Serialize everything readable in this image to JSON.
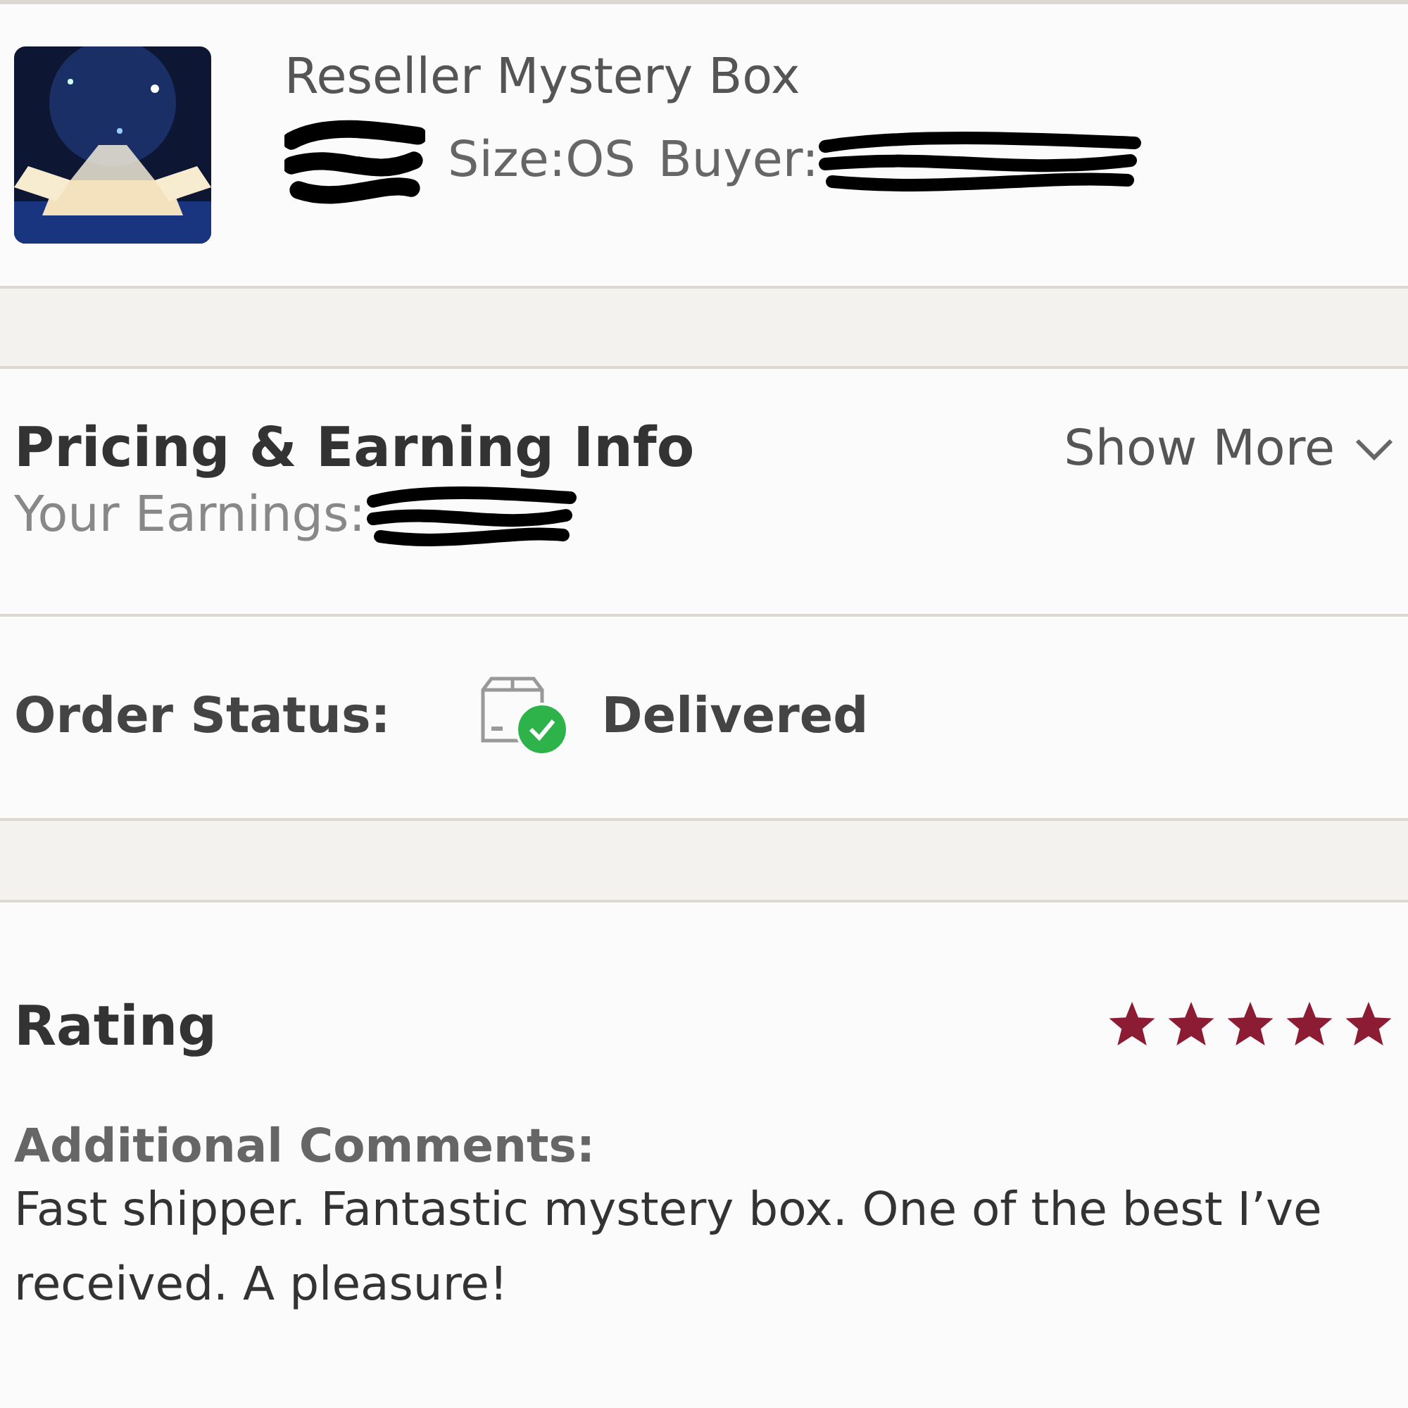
{
  "listing": {
    "title": "Reseller Mystery Box",
    "size": "Size:OS",
    "buyer_label": "Buyer:"
  },
  "pricing": {
    "title": "Pricing & Earning Info",
    "earnings_label": "Your Earnings:",
    "toggle": "Show More"
  },
  "order_status": {
    "label": "Order Status:",
    "status": "Delivered",
    "delivered": true
  },
  "rating": {
    "title": "Rating",
    "stars": 5,
    "comments_label": "Additional Comments:",
    "comment": "Fast shipper. Fantastic mystery box. One of the best I’ve received. A pleasure!"
  }
}
